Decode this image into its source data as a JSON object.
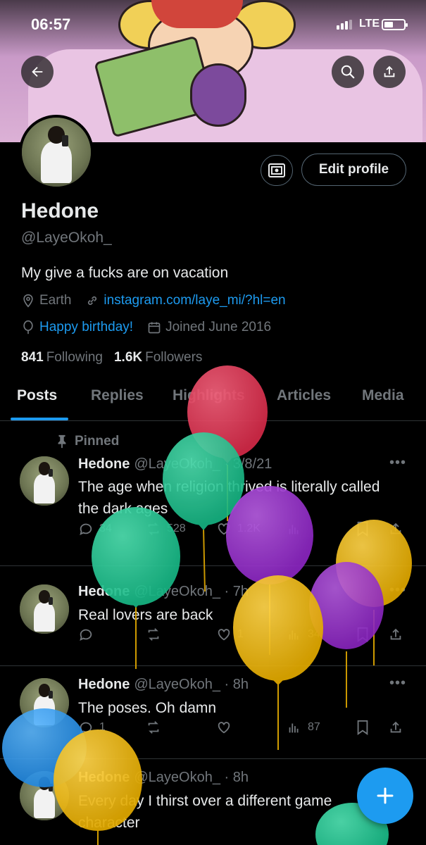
{
  "status": {
    "time": "06:57",
    "network": "LTE"
  },
  "profile": {
    "name": "Hedone",
    "handle": "@LayeOkoh_",
    "bio": "My give a fucks are on vacation",
    "location": "Earth",
    "link": "instagram.com/laye_mi/?hl=en",
    "birthday": "Happy birthday!",
    "joined": "Joined June 2016",
    "following_count": "841",
    "following_label": "Following",
    "followers_count": "1.6K",
    "followers_label": "Followers",
    "edit_label": "Edit profile"
  },
  "tabs": [
    {
      "label": "Posts"
    },
    {
      "label": "Replies"
    },
    {
      "label": "Highlights"
    },
    {
      "label": "Articles"
    },
    {
      "label": "Media"
    }
  ],
  "posts": [
    {
      "pinned_label": "Pinned",
      "name": "Hedone",
      "meta": "@LayeOkoh_ · 3/8/21",
      "text": "The age when religion thrived is literally called the dark ages",
      "replies": "34",
      "reposts": "528",
      "likes": "1.2K",
      "views": ""
    },
    {
      "name": "Hedone",
      "meta": "@LayeOkoh_ · 7h",
      "text": "Real lovers are back",
      "replies": "",
      "reposts": "",
      "likes": "1",
      "views": "34"
    },
    {
      "name": "Hedone",
      "meta": "@LayeOkoh_ · 8h",
      "text": "The poses. Oh damn",
      "replies": "1",
      "reposts": "",
      "likes": "",
      "views": "87"
    },
    {
      "name": "Hedone",
      "meta": "@LayeOkoh_ · 8h",
      "text": "Every day I thirst over a different game character"
    }
  ],
  "colors": {
    "accent": "#1d9bf0",
    "muted": "#71767b",
    "text": "#e7e9ea",
    "background": "#000000"
  },
  "icons": [
    "back-arrow-icon",
    "search-icon",
    "share-icon",
    "camera-icon",
    "location-icon",
    "link-icon",
    "balloon-icon",
    "calendar-icon",
    "pin-icon",
    "reply-icon",
    "repost-icon",
    "like-icon",
    "views-icon",
    "bookmark-icon",
    "compose-icon"
  ]
}
